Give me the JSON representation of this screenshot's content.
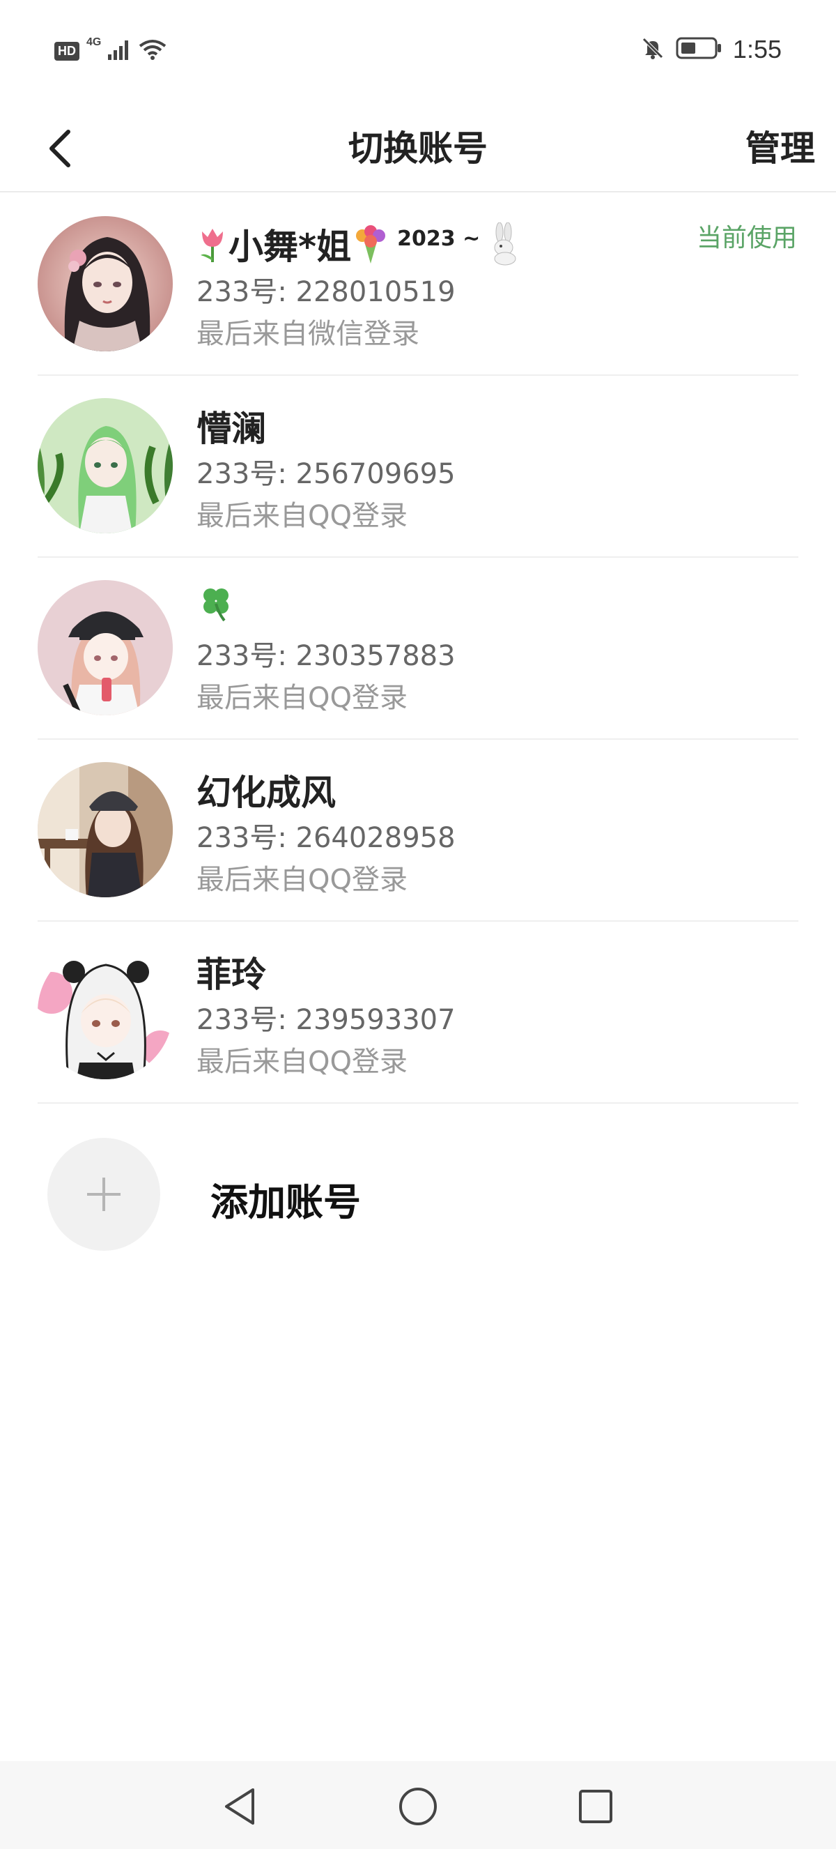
{
  "status_bar": {
    "hd_label": "HD",
    "network_label": "4G",
    "time": "1:55",
    "icons": [
      "signal-icon",
      "wifi-icon",
      "bell-off-icon",
      "battery-icon"
    ]
  },
  "header": {
    "title": "切换账号",
    "manage_label": "管理",
    "back_icon": "chevron-left-icon"
  },
  "accounts": [
    {
      "name_parts": [
        "小舞*姐",
        "2023 ~"
      ],
      "name_emojis": [
        "tulip",
        "bouquet",
        "rabbit"
      ],
      "id_text": "233号: 228010519",
      "source_text": "最后来自微信登录",
      "current_label": "当前使用",
      "avatar": "avatar-girl-dark-hair"
    },
    {
      "name": "懵澜",
      "id_text": "233号: 256709695",
      "source_text": "最后来自QQ登录",
      "avatar": "avatar-green-hair"
    },
    {
      "name_emoji": "four-leaf-clover",
      "id_text": "233号: 230357883",
      "source_text": "最后来自QQ登录",
      "avatar": "avatar-pink-girl-cap"
    },
    {
      "name": "幻化成风",
      "id_text": "233号: 264028958",
      "source_text": "最后来自QQ登录",
      "avatar": "avatar-girl-cafe"
    },
    {
      "name": "菲玲",
      "id_text": "233号: 239593307",
      "source_text": "最后来自QQ登录",
      "avatar": "avatar-panda-hood"
    }
  ],
  "add_account": {
    "label": "添加账号",
    "icon": "plus-icon"
  },
  "nav_bar": {
    "icons": [
      "back-triangle-icon",
      "home-circle-icon",
      "recents-square-icon"
    ]
  },
  "colors": {
    "current_badge": "#5aa466",
    "divider": "#efefef",
    "secondary_text": "#999999"
  }
}
